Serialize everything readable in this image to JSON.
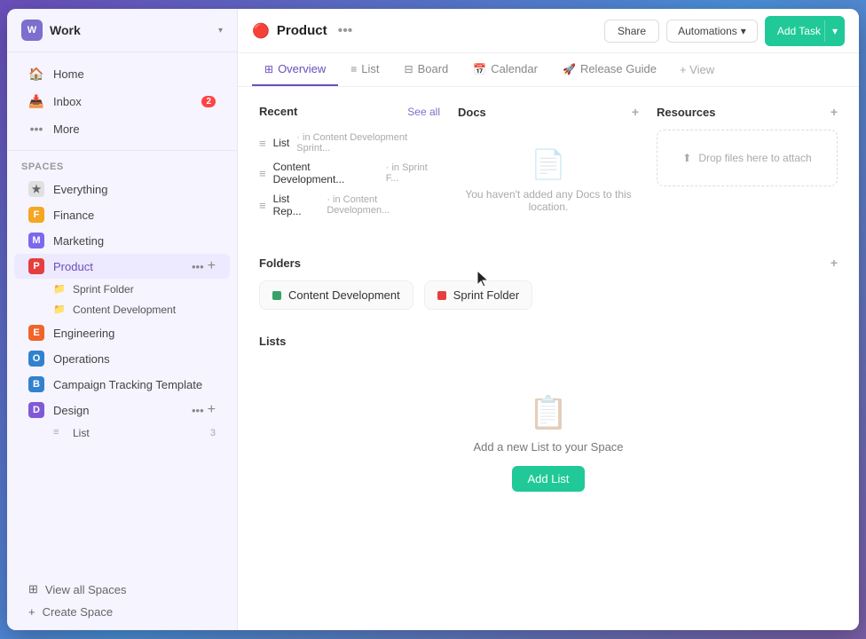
{
  "workspace": {
    "icon_letter": "W",
    "name": "Work",
    "chevron": "▾"
  },
  "nav": {
    "home_label": "Home",
    "inbox_label": "Inbox",
    "inbox_badge": "2",
    "more_label": "More"
  },
  "spaces_header": "Spaces",
  "spaces": [
    {
      "id": "everything",
      "label": "Everything",
      "color": "#888",
      "icon": "★",
      "bg": "#e0e0e0"
    },
    {
      "id": "finance",
      "label": "Finance",
      "color": "#f5a623",
      "letter": "F",
      "bg": "#f5a623"
    },
    {
      "id": "marketing",
      "label": "Marketing",
      "color": "#7b68ee",
      "letter": "M",
      "bg": "#7b68ee"
    },
    {
      "id": "product",
      "label": "Product",
      "color": "#e53e3e",
      "letter": "P",
      "bg": "#e53e3e",
      "active": true
    },
    {
      "id": "engineering",
      "label": "Engineering",
      "color": "#f06529",
      "letter": "E",
      "bg": "#f06529"
    },
    {
      "id": "operations",
      "label": "Operations",
      "color": "#3182ce",
      "letter": "O",
      "bg": "#3182ce"
    },
    {
      "id": "campaign",
      "label": "Campaign Tracking Template",
      "color": "#38a169",
      "letter": "B",
      "bg": "#3182ce"
    },
    {
      "id": "design",
      "label": "Design",
      "color": "#805ad5",
      "letter": "D",
      "bg": "#805ad5"
    }
  ],
  "product_sub": [
    {
      "label": "Sprint Folder",
      "icon": "📁"
    },
    {
      "label": "Content Development",
      "icon": "📁"
    }
  ],
  "design_sub": [
    {
      "label": "List",
      "count": "3"
    }
  ],
  "footer": {
    "view_all_spaces": "View all Spaces",
    "create_space": "Create Space"
  },
  "page": {
    "emoji": "🔴",
    "title": "Product",
    "dots": "•••"
  },
  "header_buttons": {
    "share": "Share",
    "automations": "Automations",
    "add_task": "Add Task"
  },
  "tabs": [
    {
      "id": "overview",
      "label": "Overview",
      "icon": "⊞",
      "active": true
    },
    {
      "id": "list",
      "label": "List",
      "icon": "≡"
    },
    {
      "id": "board",
      "label": "Board",
      "icon": "⊟"
    },
    {
      "id": "calendar",
      "label": "Calendar",
      "icon": "📅"
    },
    {
      "id": "release",
      "label": "Release Guide",
      "icon": "🚀"
    },
    {
      "id": "view",
      "label": "+ View"
    }
  ],
  "overview": {
    "recent": {
      "title": "Recent",
      "see_all": "See all",
      "items": [
        {
          "name": "List",
          "sub": "in Content Development Sprint..."
        },
        {
          "name": "Content Development...",
          "sub": "in Sprint F..."
        },
        {
          "name": "List Rep...",
          "sub": "in Content Developmen..."
        }
      ]
    },
    "docs": {
      "title": "Docs",
      "empty_text": "You haven't added any Docs to this location."
    },
    "resources": {
      "title": "Resources",
      "drop_text": "Drop files here to attach"
    },
    "folders": {
      "title": "Folders",
      "items": [
        {
          "label": "Content Development",
          "color": "#38a169"
        },
        {
          "label": "Sprint Folder",
          "color": "#e53e3e"
        }
      ]
    },
    "lists": {
      "title": "Lists",
      "empty_text": "Add a new List to your Space",
      "add_btn": "Add List"
    }
  }
}
